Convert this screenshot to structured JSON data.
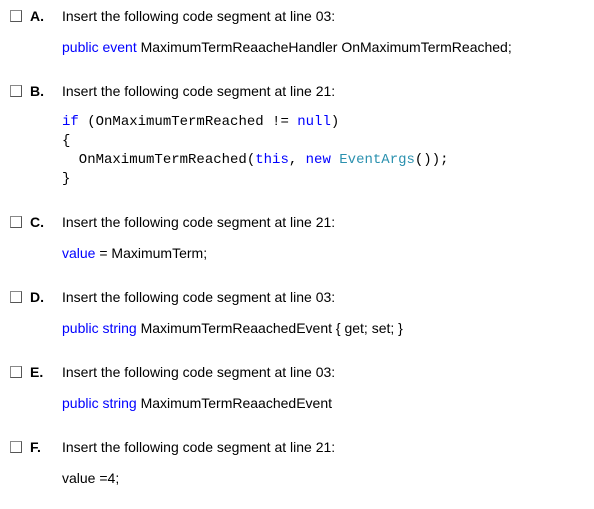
{
  "options": [
    {
      "label": "A.",
      "prompt": "Insert the following code segment at line 03:",
      "style": "sans",
      "segments": [
        [
          {
            "t": "public event ",
            "c": "kw-blue"
          },
          {
            "t": "MaximumTermReaacheHandler OnMaximumTermReached;",
            "c": ""
          }
        ]
      ]
    },
    {
      "label": "B.",
      "prompt": "Insert the following code segment at line 21:",
      "style": "mono",
      "segments": [
        [
          {
            "t": "if",
            "c": "kw-blue"
          },
          {
            "t": " (OnMaximumTermReached != ",
            "c": ""
          },
          {
            "t": "null",
            "c": "kw-blue"
          },
          {
            "t": ")",
            "c": ""
          }
        ],
        [
          {
            "t": "{",
            "c": ""
          }
        ],
        [
          {
            "t": "  OnMaximumTermReached(",
            "c": ""
          },
          {
            "t": "this",
            "c": "kw-blue"
          },
          {
            "t": ", ",
            "c": ""
          },
          {
            "t": "new",
            "c": "kw-blue"
          },
          {
            "t": " ",
            "c": ""
          },
          {
            "t": "EventArgs",
            "c": "kw-teal"
          },
          {
            "t": "());",
            "c": ""
          }
        ],
        [
          {
            "t": "}",
            "c": ""
          }
        ]
      ]
    },
    {
      "label": "C.",
      "prompt": "Insert the following code segment at line 21:",
      "style": "sans",
      "segments": [
        [
          {
            "t": "value ",
            "c": "kw-blue"
          },
          {
            "t": "= MaximumTerm;",
            "c": ""
          }
        ]
      ]
    },
    {
      "label": "D.",
      "prompt": "Insert the following code segment at line 03:",
      "style": "sans",
      "segments": [
        [
          {
            "t": "public string ",
            "c": "kw-blue"
          },
          {
            "t": "MaximumTermReaachedEvent { get; set; }",
            "c": ""
          }
        ]
      ]
    },
    {
      "label": "E.",
      "prompt": "Insert the following code segment at line 03:",
      "style": "sans",
      "segments": [
        [
          {
            "t": "public string ",
            "c": "kw-blue"
          },
          {
            "t": "MaximumTermReaachedEvent",
            "c": ""
          }
        ]
      ]
    },
    {
      "label": "F.",
      "prompt": "Insert the following code segment at line 21:",
      "style": "sans",
      "segments": [
        [
          {
            "t": "value =4;",
            "c": ""
          }
        ]
      ]
    }
  ]
}
